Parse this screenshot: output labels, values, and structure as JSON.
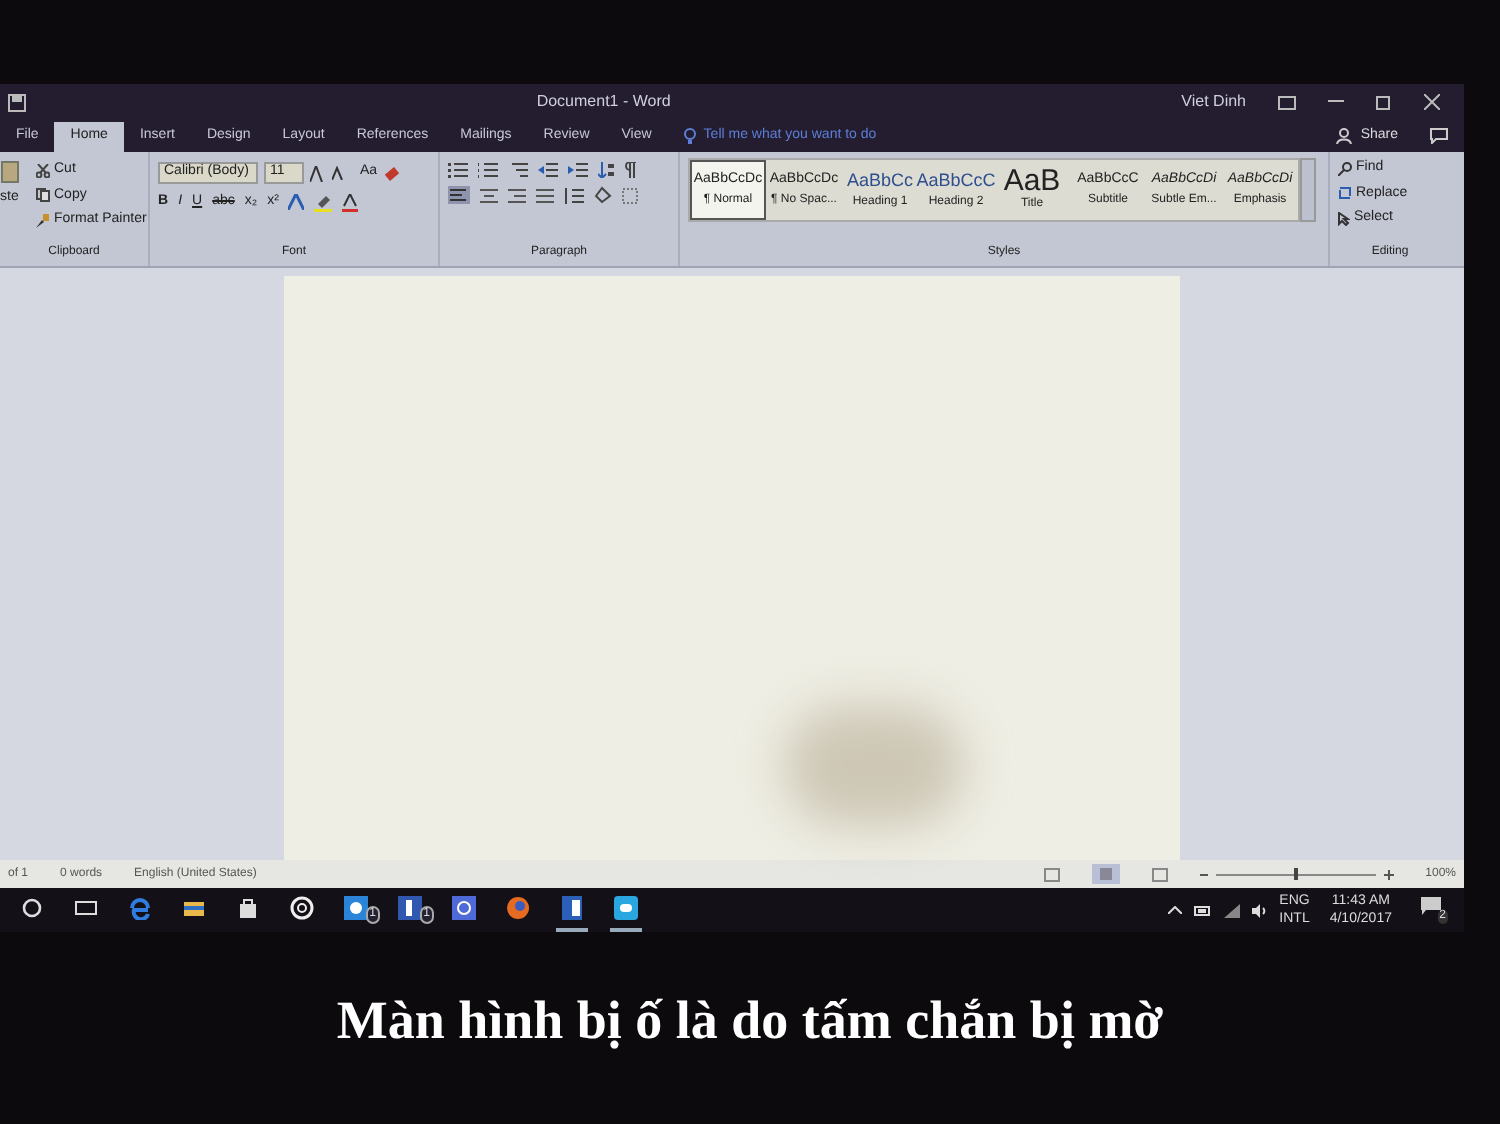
{
  "title_bar": {
    "title": "Document1 - Word",
    "user": "Viet Dinh"
  },
  "tabs": [
    {
      "label": "File",
      "selected": false
    },
    {
      "label": "Home",
      "selected": true
    },
    {
      "label": "Insert",
      "selected": false
    },
    {
      "label": "Design",
      "selected": false
    },
    {
      "label": "Layout",
      "selected": false
    },
    {
      "label": "References",
      "selected": false
    },
    {
      "label": "Mailings",
      "selected": false
    },
    {
      "label": "Review",
      "selected": false
    },
    {
      "label": "View",
      "selected": false
    }
  ],
  "tell_me": {
    "placeholder": "Tell me what you want to do"
  },
  "share": "Share",
  "clipboard": {
    "paste": "ste",
    "items": [
      "Cut",
      "Copy",
      "Format Painter"
    ],
    "label": "Clipboard"
  },
  "font": {
    "name": "Calibri (Body)",
    "size": "11",
    "case": "Aa",
    "buttons": [
      "B",
      "I",
      "U",
      "abc",
      "x₂",
      "x²"
    ],
    "label": "Font"
  },
  "paragraph": {
    "label": "Paragraph"
  },
  "styles": {
    "label": "Styles",
    "items": [
      {
        "preview": "AaBbCcDc",
        "name": "¶ Normal",
        "kind": "body",
        "selected": true
      },
      {
        "preview": "AaBbCcDc",
        "name": "¶ No Spac...",
        "kind": "body",
        "selected": false
      },
      {
        "preview": "AaBbCc",
        "name": "Heading 1",
        "kind": "heading",
        "selected": false
      },
      {
        "preview": "AaBbCcC",
        "name": "Heading 2",
        "kind": "heading",
        "selected": false
      },
      {
        "preview": "AaB",
        "name": "Title",
        "kind": "title",
        "selected": false
      },
      {
        "preview": "AaBbCcC",
        "name": "Subtitle",
        "kind": "body",
        "selected": false
      },
      {
        "preview": "AaBbCcDi",
        "name": "Subtle Em...",
        "kind": "italic",
        "selected": false
      },
      {
        "preview": "AaBbCcDi",
        "name": "Emphasis",
        "kind": "italic",
        "selected": false
      }
    ]
  },
  "editing": {
    "label": "Editing",
    "items": [
      "Find",
      "Replace",
      "Select"
    ]
  },
  "status_bar": {
    "items": [
      "of 1",
      "0 words",
      "English (United States)"
    ],
    "zoom": "100%",
    "zoom_level": {
      "level": 0.5
    }
  },
  "taskbar": {
    "apps": [
      {
        "kind": "cortana",
        "running": false
      },
      {
        "kind": "taskview",
        "running": false
      },
      {
        "kind": "edge",
        "running": false
      },
      {
        "kind": "folder",
        "running": false
      },
      {
        "kind": "store",
        "running": false
      },
      {
        "kind": "ring",
        "running": false
      },
      {
        "kind": "chat",
        "badge": "1",
        "running": false
      },
      {
        "kind": "facebook",
        "badge": "1",
        "running": false
      },
      {
        "kind": "app",
        "running": false
      },
      {
        "kind": "firefox",
        "running": false
      },
      {
        "kind": "word",
        "running": true
      },
      {
        "kind": "skype",
        "running": true
      }
    ],
    "tray": {
      "lang": "ENG",
      "layout": "INTL",
      "time": "11:43 AM",
      "date": "4/10/2017",
      "notifications": "2"
    }
  },
  "caption": "Màn hình bị ố là do tấm chắn bị mờ"
}
